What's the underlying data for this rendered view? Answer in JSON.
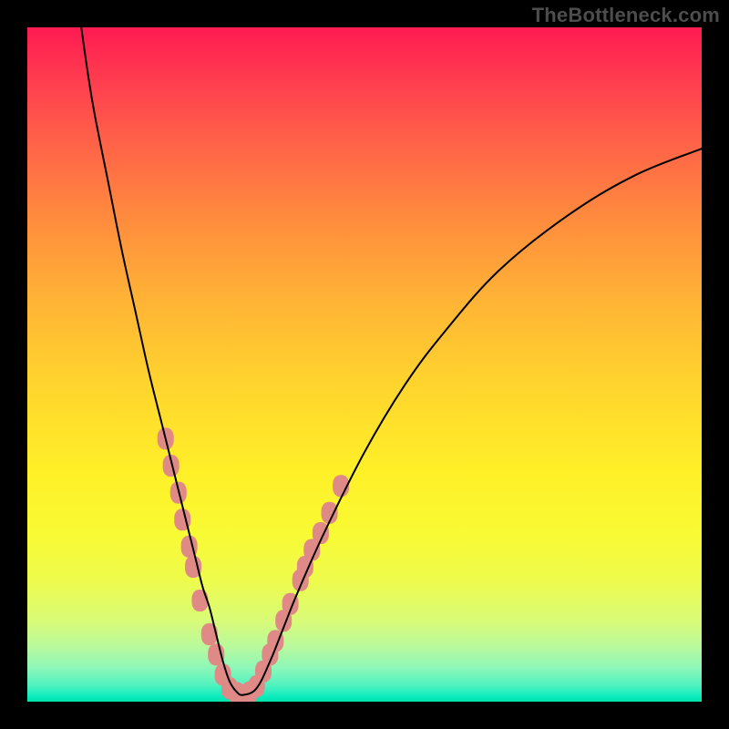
{
  "watermark": "TheBottleneck.com",
  "chart_data": {
    "type": "line",
    "title": "",
    "xlabel": "",
    "ylabel": "",
    "xlim": [
      0,
      100
    ],
    "ylim": [
      0,
      100
    ],
    "grid": false,
    "series": [
      {
        "name": "bottleneck-curve",
        "x": [
          8,
          9,
          10,
          12,
          14,
          16,
          18,
          20,
          22,
          23,
          24,
          25,
          26,
          27,
          28,
          29,
          30,
          31,
          32,
          34,
          36,
          38,
          40,
          44,
          50,
          56,
          62,
          70,
          80,
          90,
          100
        ],
        "values": [
          100,
          93,
          87,
          77,
          67,
          58,
          49,
          41,
          33,
          29,
          25,
          21,
          17,
          14,
          10,
          6,
          3,
          1.5,
          1,
          2,
          6,
          11,
          16,
          25,
          37,
          47,
          55,
          64,
          72,
          78,
          82
        ],
        "color": "#000000",
        "stroke_width": 2
      }
    ],
    "markers": [
      {
        "name": "left-cluster",
        "shape": "rounded-rect",
        "color": "#e08a87",
        "points": [
          {
            "x": 20.5,
            "y": 39
          },
          {
            "x": 21.3,
            "y": 35
          },
          {
            "x": 22.4,
            "y": 31
          },
          {
            "x": 23.0,
            "y": 27
          },
          {
            "x": 24.0,
            "y": 23
          },
          {
            "x": 24.6,
            "y": 20
          },
          {
            "x": 25.6,
            "y": 15
          },
          {
            "x": 27.0,
            "y": 10
          },
          {
            "x": 28.0,
            "y": 7
          },
          {
            "x": 29.0,
            "y": 4
          },
          {
            "x": 30.0,
            "y": 2
          },
          {
            "x": 31.0,
            "y": 1.3
          },
          {
            "x": 32.0,
            "y": 1
          }
        ]
      },
      {
        "name": "right-cluster",
        "shape": "rounded-rect",
        "color": "#e08a87",
        "points": [
          {
            "x": 33.0,
            "y": 1.4
          },
          {
            "x": 34.0,
            "y": 2.3
          },
          {
            "x": 35.0,
            "y": 4.5
          },
          {
            "x": 36.0,
            "y": 7
          },
          {
            "x": 36.8,
            "y": 9
          },
          {
            "x": 38.0,
            "y": 12
          },
          {
            "x": 39.0,
            "y": 14.5
          },
          {
            "x": 40.5,
            "y": 18
          },
          {
            "x": 41.2,
            "y": 20
          },
          {
            "x": 42.2,
            "y": 22.5
          },
          {
            "x": 43.5,
            "y": 25
          },
          {
            "x": 44.8,
            "y": 28
          },
          {
            "x": 46.5,
            "y": 32
          }
        ]
      }
    ],
    "gradient_stops": [
      {
        "pos": 0.0,
        "color": "#ff1a52"
      },
      {
        "pos": 0.3,
        "color": "#ff8a3e"
      },
      {
        "pos": 0.6,
        "color": "#ffe628"
      },
      {
        "pos": 0.85,
        "color": "#d9fb78"
      },
      {
        "pos": 1.0,
        "color": "#00e6a8"
      }
    ]
  }
}
